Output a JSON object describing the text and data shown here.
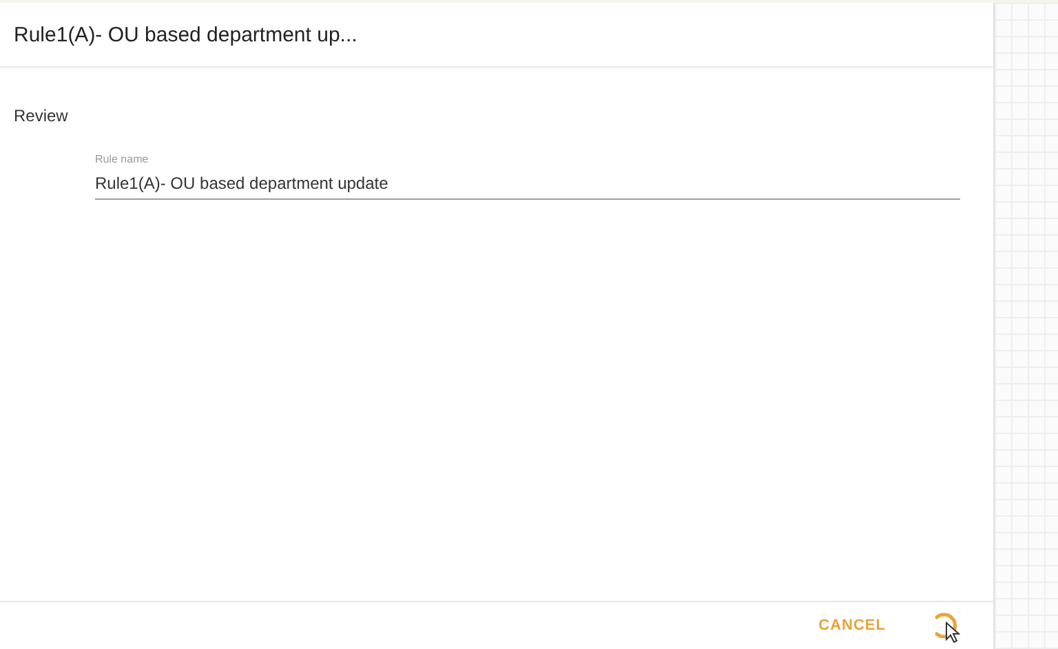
{
  "dialog": {
    "title": "Rule1(A)- OU based department up...",
    "section": "Review",
    "field": {
      "label": "Rule name",
      "value": "Rule1(A)- OU based department update"
    },
    "buttons": [
      {
        "kind": "text",
        "label": "CANCEL"
      },
      {
        "kind": "spinner"
      }
    ]
  }
}
